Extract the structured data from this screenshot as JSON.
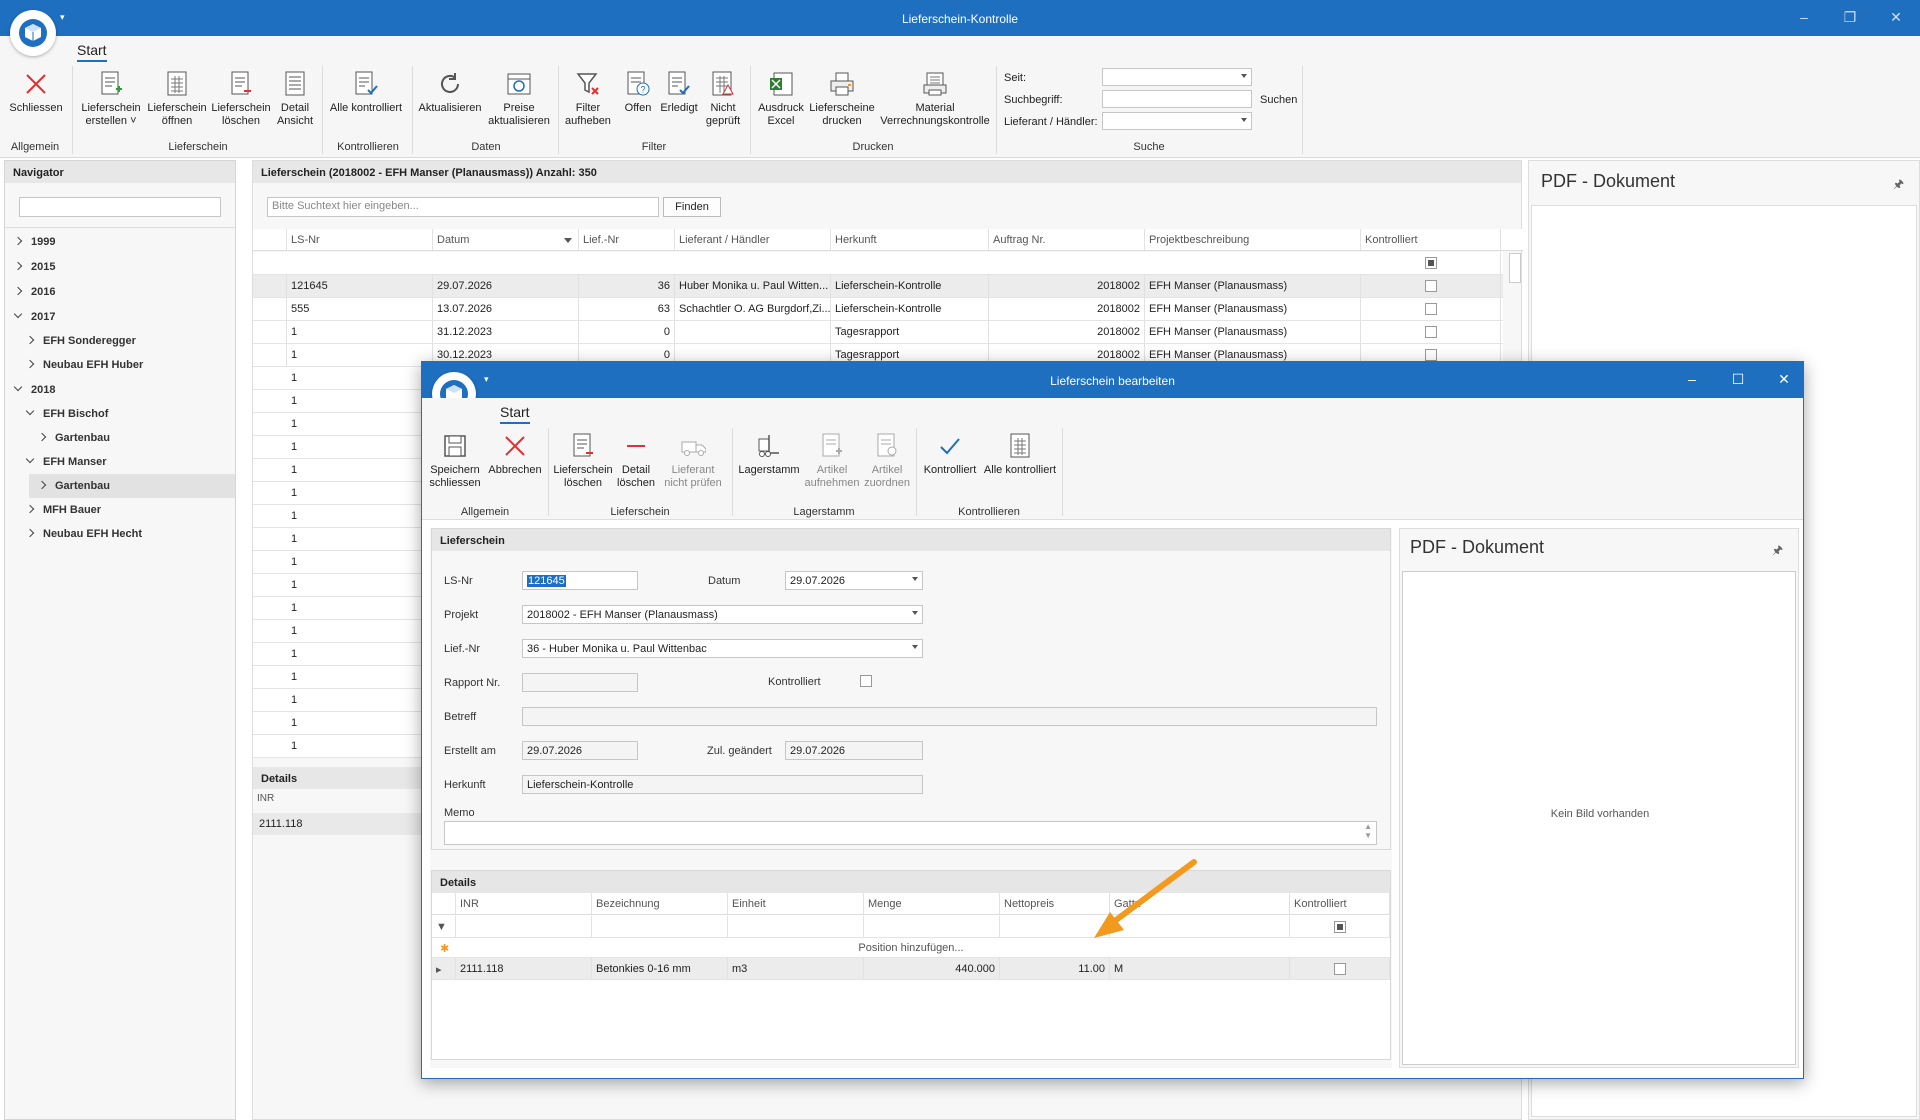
{
  "app": {
    "title": "Lieferschein-Kontrolle",
    "tab": "Start"
  },
  "ribbon": {
    "buttons": [
      {
        "label": "Schliessen"
      },
      {
        "label": "Lieferschein\nerstellen ˅"
      },
      {
        "label": "Lieferschein\nöffnen"
      },
      {
        "label": "Lieferschein\nlöschen"
      },
      {
        "label": "Detail\nAnsicht"
      },
      {
        "label": "Alle kontrolliert"
      },
      {
        "label": "Aktualisieren"
      },
      {
        "label": "Preise\naktualisieren"
      },
      {
        "label": "Filter\naufheben"
      },
      {
        "label": "Offen"
      },
      {
        "label": "Erledigt"
      },
      {
        "label": "Nicht\ngeprüft"
      },
      {
        "label": "Ausdruck\nExcel"
      },
      {
        "label": "Lieferscheine\ndrucken"
      },
      {
        "label": "Material\nVerrechnungskontrolle"
      }
    ],
    "groups": [
      "Allgemein",
      "Lieferschein",
      "Kontrollieren",
      "Daten",
      "Filter",
      "Drucken",
      "Suche"
    ],
    "search": {
      "seit_label": "Seit:",
      "suchbegriff_label": "Suchbegriff:",
      "lieferant_label": "Lieferant / Händler:",
      "suchen_label": "Suchen"
    }
  },
  "navigator": {
    "title": "Navigator",
    "items": [
      "1999",
      "2015",
      "2016",
      "2017",
      "EFH Sonderegger",
      "Neubau EFH Huber",
      "2018",
      "EFH Bischof",
      "Gartenbau",
      "EFH Manser",
      "Gartenbau",
      "MFH Bauer",
      "Neubau EFH Hecht"
    ]
  },
  "main": {
    "header": "Lieferschein (2018002 - EFH Manser (Planausmass)) Anzahl: 350",
    "search_placeholder": "Bitte Suchtext hier eingeben...",
    "find_label": "Finden",
    "columns": [
      "LS-Nr",
      "Datum",
      "Lief.-Nr",
      "Lieferant / Händler",
      "Herkunft",
      "Auftrag Nr.",
      "Projektbeschreibung",
      "Kontrolliert"
    ],
    "rows": [
      [
        "121645",
        "29.07.2026",
        "36",
        "Huber Monika u. Paul Witten...",
        "Lieferschein-Kontrolle",
        "2018002",
        "EFH Manser (Planausmass)"
      ],
      [
        "555",
        "13.07.2026",
        "63",
        "Schachtler O. AG Burgdorf,Zi...",
        "Lieferschein-Kontrolle",
        "2018002",
        "EFH Manser (Planausmass)"
      ],
      [
        "1",
        "31.12.2023",
        "0",
        "",
        "Tagesrapport",
        "2018002",
        "EFH Manser (Planausmass)"
      ],
      [
        "1",
        "30.12.2023",
        "0",
        "",
        "Tagesrapport",
        "2018002",
        "EFH Manser (Planausmass)"
      ]
    ],
    "ls_ones": [
      "1",
      "1",
      "1",
      "1",
      "1",
      "1",
      "1",
      "1",
      "1",
      "1",
      "1",
      "1",
      "1",
      "1",
      "1",
      "1",
      "1"
    ],
    "details_title": "Details",
    "details_col": "INR",
    "details_val": "2111.118",
    "pdf_title": "PDF - Dokument",
    "pin_icon": "🖈"
  },
  "dialog": {
    "title": "Lieferschein bearbeiten",
    "tab": "Start",
    "buttons": [
      {
        "label": "Speichern\nschliessen"
      },
      {
        "label": "Abbrechen"
      },
      {
        "label": "Lieferschein\nlöschen"
      },
      {
        "label": "Detail\nlöschen"
      },
      {
        "label": "Lieferant\nnicht prüfen"
      },
      {
        "label": "Lagerstamm"
      },
      {
        "label": "Artikel\naufnehmen"
      },
      {
        "label": "Artikel\nzuordnen"
      },
      {
        "label": "Kontrolliert"
      },
      {
        "label": "Alle kontrolliert"
      }
    ],
    "groups": [
      "Allgemein",
      "Lieferschein",
      "Lagerstamm",
      "Kontrollieren"
    ],
    "form": {
      "section": "Lieferschein",
      "lsnr_label": "LS-Nr",
      "lsnr": "121645",
      "datum_label": "Datum",
      "datum": "29.07.2026",
      "projekt_label": "Projekt",
      "projekt": "2018002 - EFH Manser (Planausmass)",
      "liefnr_label": "Lief.-Nr",
      "liefnr": "36 - Huber Monika u. Paul Wittenbac",
      "rapport_label": "Rapport Nr.",
      "kontrolliert_label": "Kontrolliert",
      "betreff_label": "Betreff",
      "erstellt_label": "Erstellt am",
      "erstellt": "29.07.2026",
      "geaendert_label": "Zul. geändert",
      "geaendert": "29.07.2026",
      "herkunft_label": "Herkunft",
      "herkunft": "Lieferschein-Kontrolle",
      "memo_label": "Memo"
    },
    "details": {
      "title": "Details",
      "columns": [
        "INR",
        "Bezeichnung",
        "Einheit",
        "Menge",
        "Nettopreis",
        "Gattu",
        "Kontrolliert"
      ],
      "add_row": "Position hinzufügen...",
      "row": [
        "2111.118",
        "Betonkies 0-16 mm",
        "m3",
        "440.000",
        "11.00",
        "M"
      ]
    },
    "pdf_title": "PDF - Dokument",
    "no_image": "Kein Bild vorhanden"
  },
  "colors": {
    "accent": "#1e6fc0",
    "annotation_arrow": "#f39a1e"
  }
}
